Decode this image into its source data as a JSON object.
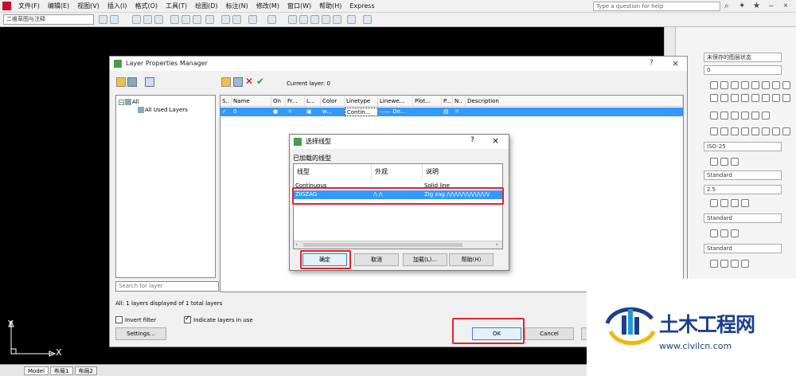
{
  "menu": [
    "文件(F)",
    "编辑(E)",
    "视图(V)",
    "插入(I)",
    "格式(O)",
    "工具(T)",
    "绘图(D)",
    "标注(N)",
    "修改(M)",
    "窗口(W)",
    "帮助(H)",
    "Express"
  ],
  "help_placeholder": "Type a question for help",
  "workspace": "二维草图与注释",
  "palette": {
    "layer_state": "未保存的图层状态",
    "layer_value": "0",
    "dim_style": "ISO-25",
    "text_style": "Standard",
    "text_height": "2.5",
    "table_style1": "Standard",
    "table_style2": "Standard"
  },
  "tabs": [
    "Model",
    "布局1",
    "布局2"
  ],
  "ucs": {
    "y": "Y",
    "x": "X"
  },
  "lpm": {
    "title": "Layer Properties Manager",
    "q": "?",
    "x": "×",
    "current_layer": "Current layer: 0",
    "tree_all": "All",
    "tree_used": "All Used Layers",
    "search_placeholder": "Search for layer",
    "columns": [
      "S..",
      "Name",
      "On",
      "Fr...",
      "L...",
      "Color",
      "Linetype",
      "Linewe...",
      "Plot...",
      "P...",
      "N..",
      "Description"
    ],
    "row": {
      "name": "0",
      "color": "w...",
      "linetype": "Contin...",
      "lineweight": "—— De..."
    },
    "status": "All: 1 layers displayed of 1 total layers",
    "invert_filter": "Invert filter",
    "indicate_layers": "Indicate layers in use",
    "settings": "Settings...",
    "ok": "OK",
    "cancel": "Cancel"
  },
  "sld": {
    "title": "选择线型",
    "q": "?",
    "x": "×",
    "loaded_label": "已加载的线型",
    "col_linetype": "线型",
    "col_appearance": "外观",
    "col_desc": "说明",
    "rows": [
      {
        "name": "Continuous",
        "appearance": "______________",
        "desc": "Solid line"
      },
      {
        "name": "ZIGZAG",
        "appearance": "/\\  /\\",
        "desc": "Zig zag /\\/\\/\\/\\/\\/\\/\\/\\/\\/\\/\\/"
      }
    ],
    "ok": "确定",
    "cancel": "取消",
    "load": "加载(L)...",
    "help": "帮助(H)"
  },
  "watermark": {
    "name": "土木工程网",
    "url": "www.civilcn.com"
  },
  "colors": {
    "accent": "#3399ff",
    "highlight": "#e0242c",
    "brand": "#1d3f8a"
  }
}
